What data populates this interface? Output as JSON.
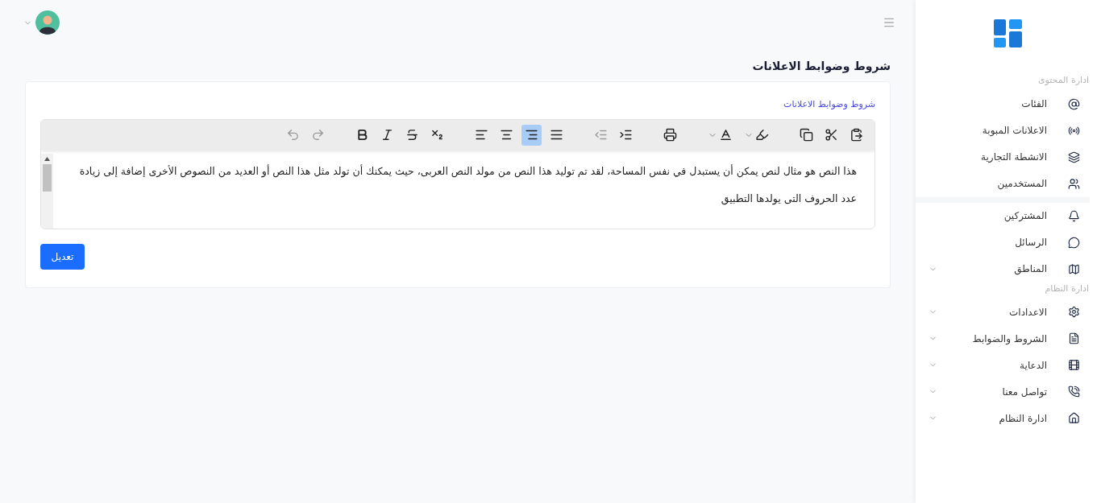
{
  "sidebar": {
    "sections": [
      {
        "title": "ادارة المحتوى",
        "items": [
          {
            "label": "الفئات",
            "expandable": false
          },
          {
            "label": "الاعلانات المبوبة",
            "expandable": false
          },
          {
            "label": "الانشطة التجارية",
            "expandable": false
          },
          {
            "label": "المستخدمين",
            "expandable": false
          },
          {
            "label": "المشتركين",
            "expandable": false
          },
          {
            "label": "الرسائل",
            "expandable": false
          },
          {
            "label": "المناطق",
            "expandable": true
          }
        ]
      },
      {
        "title": "ادارة النظام",
        "items": [
          {
            "label": "الاعدادات",
            "expandable": true
          },
          {
            "label": "الشروط والضوابط",
            "expandable": true
          },
          {
            "label": "الدعاية",
            "expandable": true
          },
          {
            "label": "تواصل معنا",
            "expandable": true
          },
          {
            "label": "ادارة النظام",
            "expandable": true
          }
        ]
      }
    ]
  },
  "page": {
    "title": "شروط وضوابط الاعلانات"
  },
  "form": {
    "label": "شروط وضوابط الاعلانات",
    "toolbar": [
      {
        "kind": "paste",
        "selected": false,
        "disabled": false
      },
      {
        "kind": "cut",
        "selected": false,
        "disabled": false
      },
      {
        "kind": "copy",
        "selected": false,
        "disabled": false
      },
      {
        "kind": "highlight",
        "selected": false,
        "disabled": false
      },
      {
        "kind": "fontcolor",
        "selected": false,
        "disabled": false
      },
      {
        "kind": "print",
        "selected": false,
        "disabled": false
      },
      {
        "kind": "indent",
        "selected": false,
        "disabled": false
      },
      {
        "kind": "outdent",
        "selected": false,
        "disabled": true
      },
      {
        "kind": "justify",
        "selected": false,
        "disabled": false
      },
      {
        "kind": "alignright",
        "selected": true,
        "disabled": false
      },
      {
        "kind": "aligncenter",
        "selected": false,
        "disabled": false
      },
      {
        "kind": "alignleft",
        "selected": false,
        "disabled": false
      },
      {
        "kind": "subscript",
        "selected": false,
        "disabled": false
      },
      {
        "kind": "strike",
        "selected": false,
        "disabled": false
      },
      {
        "kind": "italic",
        "selected": false,
        "disabled": false
      },
      {
        "kind": "bold",
        "selected": false,
        "disabled": false
      },
      {
        "kind": "redo",
        "selected": false,
        "disabled": true
      },
      {
        "kind": "undo",
        "selected": false,
        "disabled": true
      }
    ],
    "content": "هذا النص هو مثال لنص يمكن أن يستبدل في نفس المساحة، لقد تم توليد هذا النص من مولد النص العربى، حيث يمكنك أن تولد مثل هذا النص أو العديد من النصوص الأخرى إضافة إلى زيادة عدد الحروف التى يولدها التطبيق",
    "submit": "تعديل"
  }
}
